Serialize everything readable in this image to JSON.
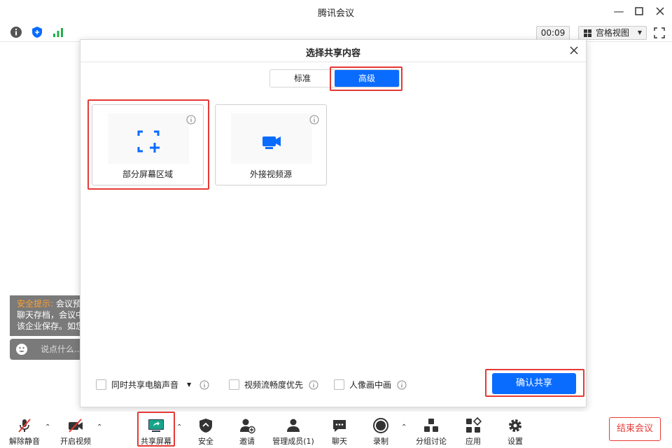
{
  "window": {
    "title": "腾讯会议"
  },
  "status": {
    "timer": "00:09",
    "view_label": "宫格视图"
  },
  "chat": {
    "tip_warn": "安全提示:",
    "tip_line1_rest": " 会议预",
    "tip_line2": "聊天存档，会议中",
    "tip_line3": "该企业保存。如您",
    "input_placeholder": "说点什么..."
  },
  "dialog": {
    "title": "选择共享内容",
    "tabs": {
      "standard": "标准",
      "advanced": "高级"
    },
    "cards": {
      "partial": "部分屏幕区域",
      "external": "外接视频源"
    },
    "options": {
      "system_audio": "同时共享电脑声音",
      "smooth_video": "视频流畅度优先",
      "pip": "人像画中画"
    },
    "confirm": "确认共享"
  },
  "toolbar": {
    "unmute": "解除静音",
    "video": "开启视频",
    "share": "共享屏幕",
    "security": "安全",
    "invite": "邀请",
    "members": "管理成员(1)",
    "chat": "聊天",
    "record": "录制",
    "breakout": "分组讨论",
    "apps": "应用",
    "settings": "设置",
    "end": "结束会议"
  },
  "colors": {
    "accent": "#0a6cff",
    "danger": "#e53935",
    "warning": "#ff9e2c"
  }
}
